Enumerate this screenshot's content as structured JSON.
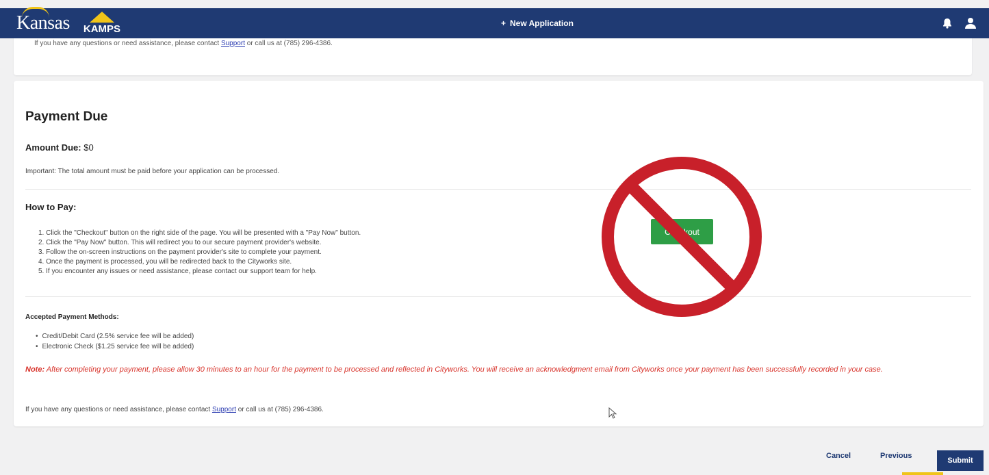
{
  "header": {
    "logo_kansas": "Kansas",
    "logo_kamps": "KAMPS",
    "new_application_icon": "plus-icon",
    "new_application_label": "New Application",
    "icons": [
      "bell-icon",
      "user-icon"
    ]
  },
  "top_card": {
    "text_before": "If you have any questions or need assistance, please contact ",
    "link": "Support",
    "text_after": " or call us at (785) 296-4386."
  },
  "payment": {
    "title": "Payment Due",
    "amount_label": "Amount Due:",
    "amount_value": "$0",
    "important": "Important: The total amount must be paid before your application can be processed.",
    "how_to_pay_title": "How to Pay:",
    "steps": [
      "1. Click the \"Checkout\" button on the right side of the page. You will be presented with a \"Pay Now\" button.",
      "2. Click the \"Pay Now\" button. This will redirect you to our secure payment provider's website.",
      "3. Follow the on-screen instructions on the payment provider's site to complete your payment.",
      "4. Once the payment is processed, you will be redirected back to the Cityworks site.",
      "5. If you encounter any issues or need assistance, please contact our support team for help."
    ],
    "accepted_title": "Accepted Payment Methods:",
    "methods": [
      "Credit/Debit Card (2.5% service fee will be added)",
      "Electronic Check ($1.25 service fee will be added)"
    ],
    "note_label": "Note:",
    "note_text": " After completing your payment, please allow 30 minutes to an hour for the payment to be processed and reflected in Cityworks. You will receive an acknowledgment email from Cityworks once your payment has been successfully recorded in your case.",
    "contact_before": "If you have any questions or need assistance, please contact ",
    "contact_link": "Support",
    "contact_after": " or call us at (785) 296-4386.",
    "checkout_label": "Checkout"
  },
  "footer": {
    "cancel": "Cancel",
    "previous": "Previous",
    "submit": "Submit"
  },
  "colors": {
    "nav": "#1f3a73",
    "accent_yellow": "#f0c419",
    "checkout_green": "#2e9e46",
    "note_red": "#d8332b",
    "prohibit_red": "#c8202a"
  }
}
